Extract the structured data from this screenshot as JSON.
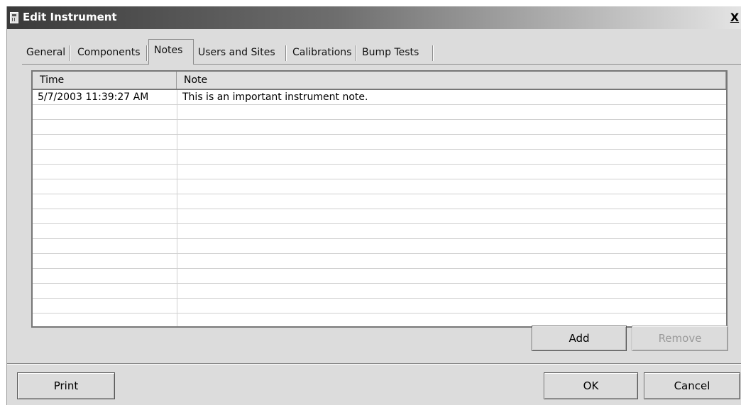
{
  "window": {
    "title": "Edit Instrument",
    "close_label": "X"
  },
  "tabs": [
    {
      "label": "General",
      "active": false
    },
    {
      "label": "Components",
      "active": false
    },
    {
      "label": "Notes",
      "active": true
    },
    {
      "label": "Users and Sites",
      "active": false
    },
    {
      "label": "Calibrations",
      "active": false
    },
    {
      "label": "Bump Tests",
      "active": false
    }
  ],
  "notes_table": {
    "columns": [
      "Time",
      "Note"
    ],
    "rows": [
      [
        "5/7/2003 11:39:27 AM",
        "This is an important instrument note."
      ]
    ]
  },
  "buttons": {
    "add": "Add",
    "remove": "Remove",
    "print": "Print",
    "ok": "OK",
    "cancel": "Cancel"
  }
}
